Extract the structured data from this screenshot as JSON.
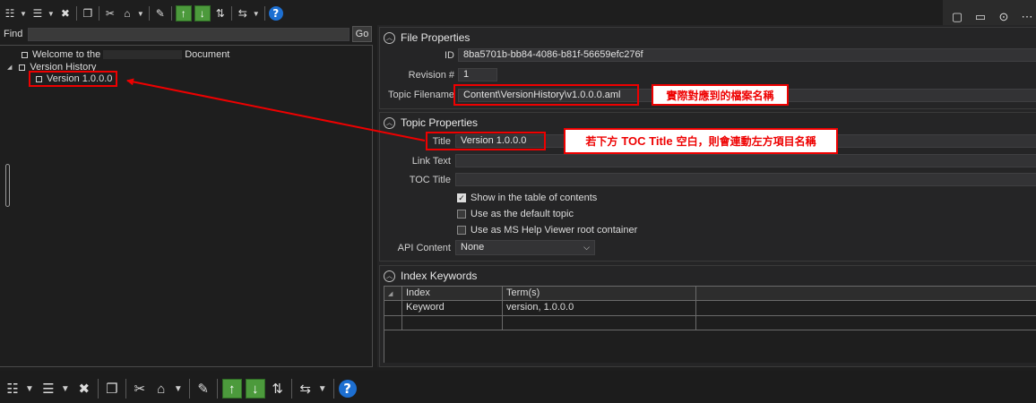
{
  "toolbar": {
    "buttons": [
      {
        "name": "add-sibling-topic-button",
        "glyph": "☷",
        "caret": true
      },
      {
        "name": "add-child-topic-button",
        "glyph": "☰",
        "caret": true
      },
      {
        "name": "delete-topic-button",
        "glyph": "✖",
        "caret": false,
        "sep": true
      },
      {
        "name": "copy-button",
        "glyph": "❐",
        "caret": false,
        "sep": true
      },
      {
        "name": "cut-button",
        "glyph": "✂",
        "caret": false
      },
      {
        "name": "paste-button",
        "glyph": "⌂",
        "caret": true,
        "sep": true
      },
      {
        "name": "edit-topic-button",
        "glyph": "✎",
        "caret": false,
        "sep": true
      },
      {
        "name": "move-up-button",
        "glyph": "↑",
        "caret": false,
        "cls": "green"
      },
      {
        "name": "move-down-button",
        "glyph": "↓",
        "caret": false,
        "cls": "green"
      },
      {
        "name": "sort-button",
        "glyph": "⇅",
        "caret": false,
        "sep": true
      },
      {
        "name": "expand-collapse-button",
        "glyph": "⇆",
        "caret": true,
        "sep": true
      },
      {
        "name": "help-button",
        "glyph": "?",
        "caret": false,
        "cls": "blue-round"
      }
    ],
    "right_icons": [
      {
        "name": "comment-icon",
        "glyph": "▢"
      },
      {
        "name": "monitor-icon",
        "glyph": "▭"
      },
      {
        "name": "download-icon",
        "glyph": "⊙"
      },
      {
        "name": "more-icon",
        "glyph": "⋯"
      }
    ]
  },
  "find": {
    "label": "Find",
    "value": "",
    "go_label": "Go"
  },
  "tree": {
    "welcome": {
      "prefix": "Welcome to the",
      "suffix": "Document"
    },
    "version_history": {
      "expander": "◢",
      "label": "Version History"
    },
    "version_item": {
      "label": "Version 1.0.0.0"
    }
  },
  "file_properties": {
    "header": "File Properties",
    "id_label": "ID",
    "id_value": "8ba5701b-bb84-4086-b81f-56659efc276f",
    "revision_label": "Revision #",
    "revision_value": "1",
    "filename_label": "Topic Filename",
    "filename_value": "Content\\VersionHistory\\v1.0.0.0.aml"
  },
  "topic_properties": {
    "header": "Topic Properties",
    "title_label": "Title",
    "title_value": "Version 1.0.0.0",
    "link_text_label": "Link Text",
    "link_text_value": "",
    "toc_title_label": "TOC Title",
    "toc_title_value": "",
    "checkboxes": [
      {
        "label": "Show in the table of contents",
        "checked": true
      },
      {
        "label": "Use as the default topic",
        "checked": false
      },
      {
        "label": "Use as MS Help Viewer root container",
        "checked": false
      }
    ],
    "api_label": "API Content",
    "api_value": "None"
  },
  "index_keywords": {
    "header": "Index Keywords",
    "columns": [
      "Index",
      "Term(s)"
    ],
    "rows": [
      [
        "Keyword",
        "version, 1.0.0.0"
      ],
      [
        "",
        ""
      ]
    ]
  },
  "annotations": {
    "filename_note": "實際對應到的檔案名稱",
    "title_note_pre": "若下方",
    "title_note_em": "TOC Title",
    "title_note_post": "空白，則會連動左方項目名稱"
  }
}
